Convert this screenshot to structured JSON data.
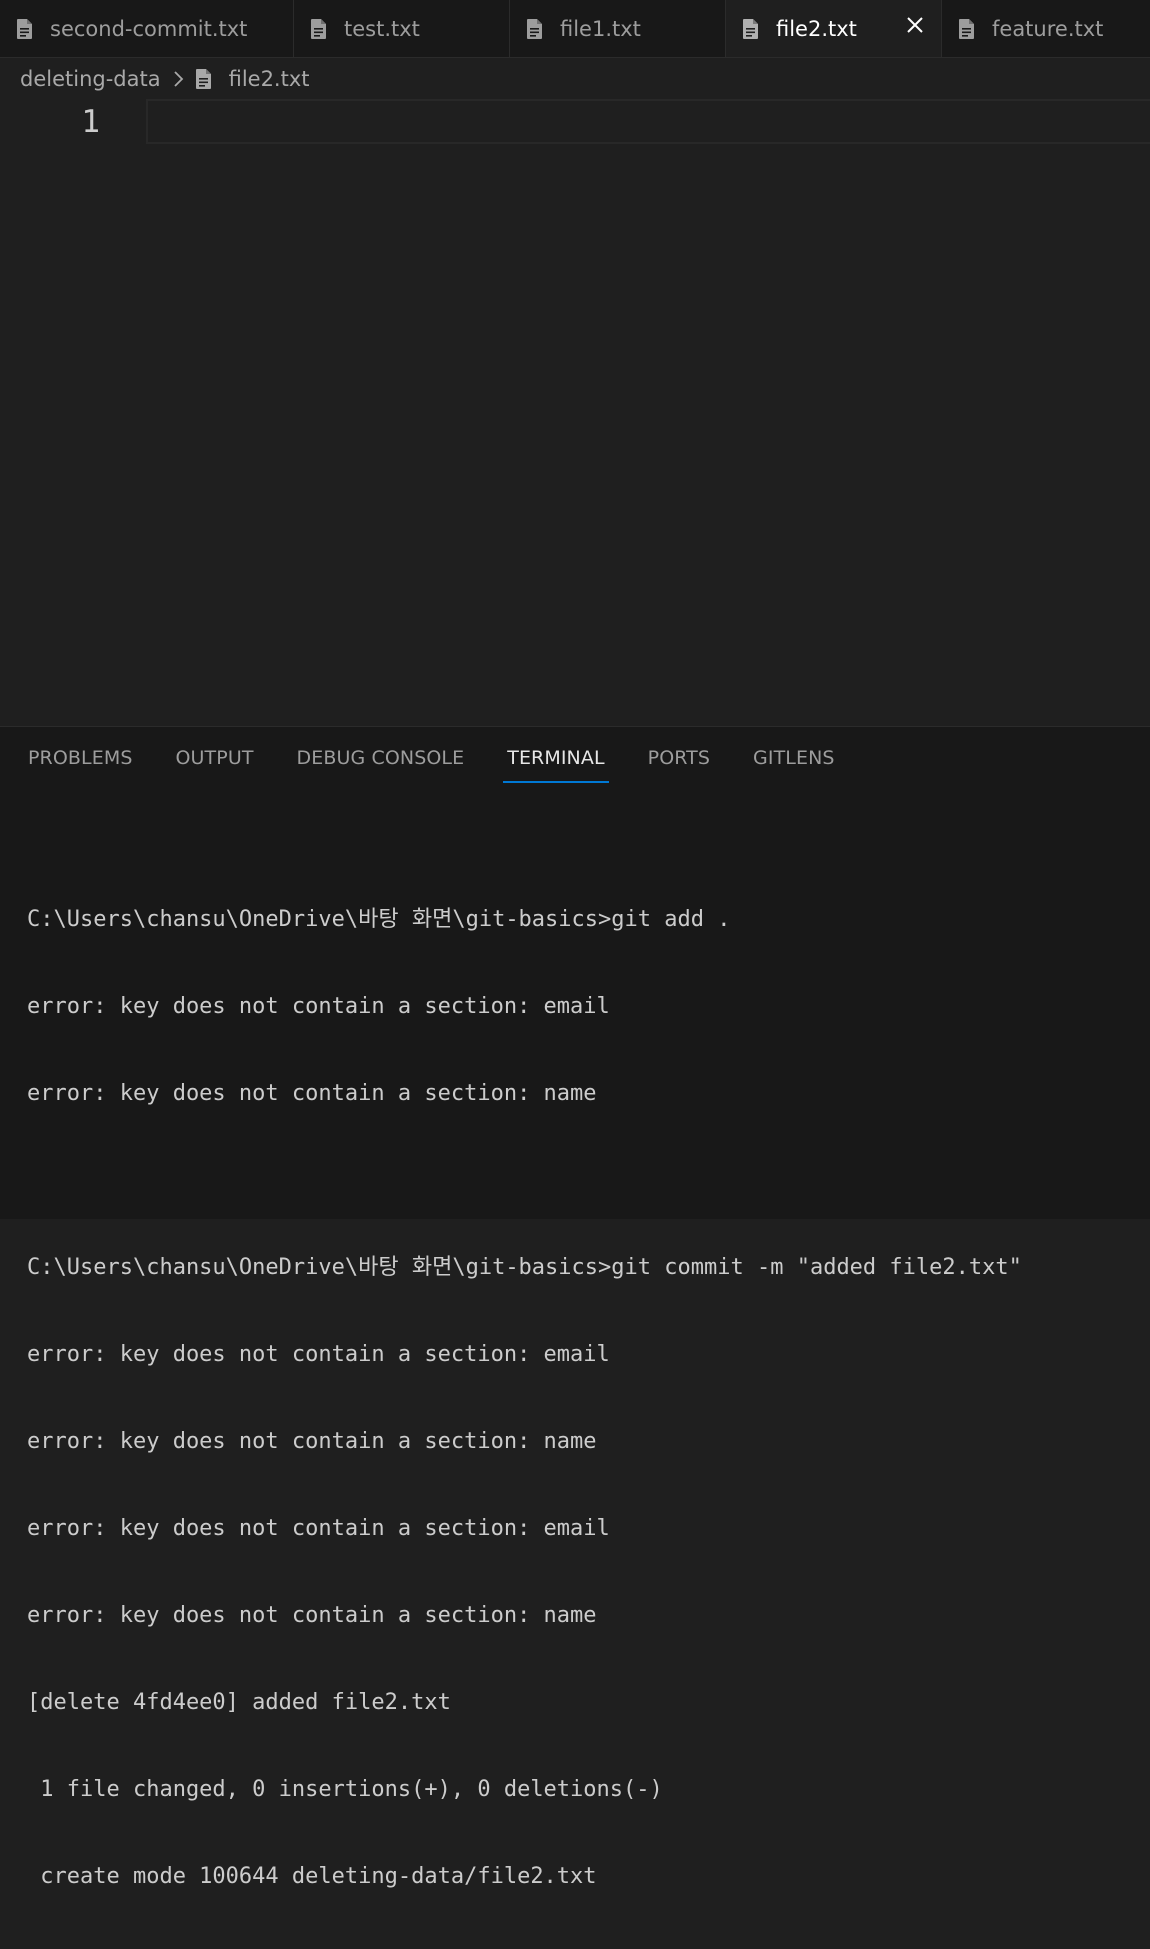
{
  "tabs": [
    {
      "label": "second-commit.txt",
      "active": false
    },
    {
      "label": "test.txt",
      "active": false
    },
    {
      "label": "file1.txt",
      "active": false
    },
    {
      "label": "file2.txt",
      "active": true
    },
    {
      "label": "feature.txt",
      "active": false
    }
  ],
  "breadcrumb": {
    "folder": "deleting-data",
    "file": "file2.txt"
  },
  "editor": {
    "line_numbers": [
      "1"
    ]
  },
  "panel": {
    "tabs": [
      {
        "label": "PROBLEMS",
        "active": false
      },
      {
        "label": "OUTPUT",
        "active": false
      },
      {
        "label": "DEBUG CONSOLE",
        "active": false
      },
      {
        "label": "TERMINAL",
        "active": true
      },
      {
        "label": "PORTS",
        "active": false
      },
      {
        "label": "GITLENS",
        "active": false
      }
    ]
  },
  "terminal": {
    "lines": [
      "C:\\Users\\chansu\\OneDrive\\바탕 화면\\git-basics>git add .",
      "error: key does not contain a section: email",
      "error: key does not contain a section: name",
      "",
      "C:\\Users\\chansu\\OneDrive\\바탕 화면\\git-basics>git commit -m \"added file2.txt\"",
      "error: key does not contain a section: email",
      "error: key does not contain a section: name",
      "error: key does not contain a section: email",
      "error: key does not contain a section: name",
      "[delete 4fd4ee0] added file2.txt",
      " 1 file changed, 0 insertions(+), 0 deletions(-)",
      " create mode 100644 deleting-data/file2.txt"
    ]
  },
  "colors": {
    "editor_bg": "#1f1f1f",
    "tabbar_bg": "#181818",
    "panel_bg": "#181818",
    "accent": "#0078d4",
    "file_icon": "#9d9d9d"
  },
  "icons": {
    "file": "file-text-icon",
    "close": "close-icon",
    "chevron": "chevron-right-icon"
  }
}
